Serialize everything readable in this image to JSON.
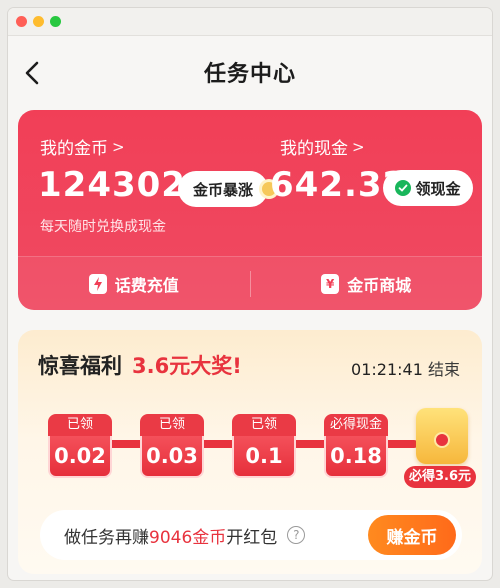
{
  "nav": {
    "title": "任务中心"
  },
  "wallet": {
    "coins_label": "我的金币",
    "coins_value": "124302",
    "coins_boost_label": "金币暴涨",
    "cash_label": "我的现金",
    "cash_value": "642.32",
    "claim_cash_label": "领现金",
    "subtitle": "每天随时兑换成现金",
    "actions": [
      {
        "label": "话费充值",
        "icon": "lightning-icon"
      },
      {
        "label": "金币商城",
        "icon": "yen-icon"
      }
    ],
    "chevron": ">"
  },
  "bonus": {
    "title": "惊喜福利",
    "prize": "3.6元大奖!",
    "countdown_time": "01:21:41",
    "countdown_suffix": "结束",
    "steps": [
      {
        "status": "已领",
        "amount": "0.02"
      },
      {
        "status": "已领",
        "amount": "0.03"
      },
      {
        "status": "已领",
        "amount": "0.1"
      },
      {
        "status": "必得现金",
        "amount": "0.18"
      }
    ],
    "final_prize_badge": "必得3.6元",
    "task_prefix": "做任务再赚",
    "task_amount": "9046金币",
    "task_suffix": "开红包",
    "earn_button_label": "赚金币"
  },
  "colors": {
    "accent_red": "#f13f57",
    "prize_red": "#e8333e",
    "earn_orange": "#ff7a1c",
    "check_green": "#19b65b"
  }
}
